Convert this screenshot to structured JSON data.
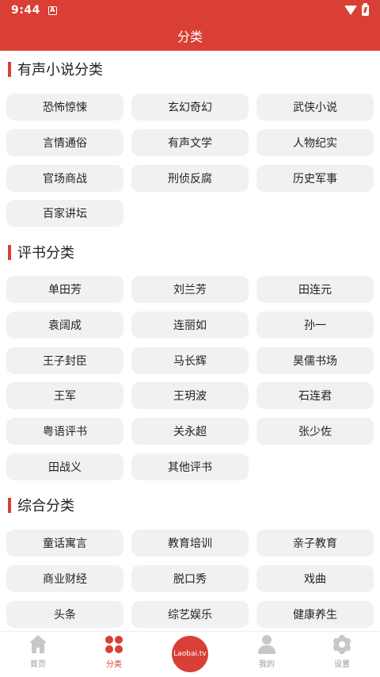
{
  "status": {
    "time": "9:44",
    "notif_glyph": "A"
  },
  "appbar": {
    "title": "分类"
  },
  "sections": [
    {
      "title": "有声小说分类",
      "items": [
        "恐怖惊悚",
        "玄幻奇幻",
        "武侠小说",
        "言情通俗",
        "有声文学",
        "人物纪实",
        "官场商战",
        "刑侦反腐",
        "历史军事",
        "百家讲坛"
      ]
    },
    {
      "title": "评书分类",
      "items": [
        "单田芳",
        "刘兰芳",
        "田连元",
        "袁阔成",
        "连丽如",
        "孙一",
        "王子封臣",
        "马长辉",
        "昊儒书场",
        "王军",
        "王玥波",
        "石连君",
        "粤语评书",
        "关永超",
        "张少佐",
        "田战义",
        "其他评书"
      ]
    },
    {
      "title": "综合分类",
      "items": [
        "童话寓言",
        "教育培训",
        "亲子教育",
        "商业财经",
        "脱口秀",
        "戏曲",
        "头条",
        "综艺娱乐",
        "健康养生"
      ]
    }
  ],
  "nav": {
    "home": "首页",
    "category": "分类",
    "logo": "Laobai.tv",
    "mine": "我的",
    "settings": "设置"
  },
  "colors": {
    "accent": "#d93f35",
    "chip_bg": "#f1f1f3"
  }
}
